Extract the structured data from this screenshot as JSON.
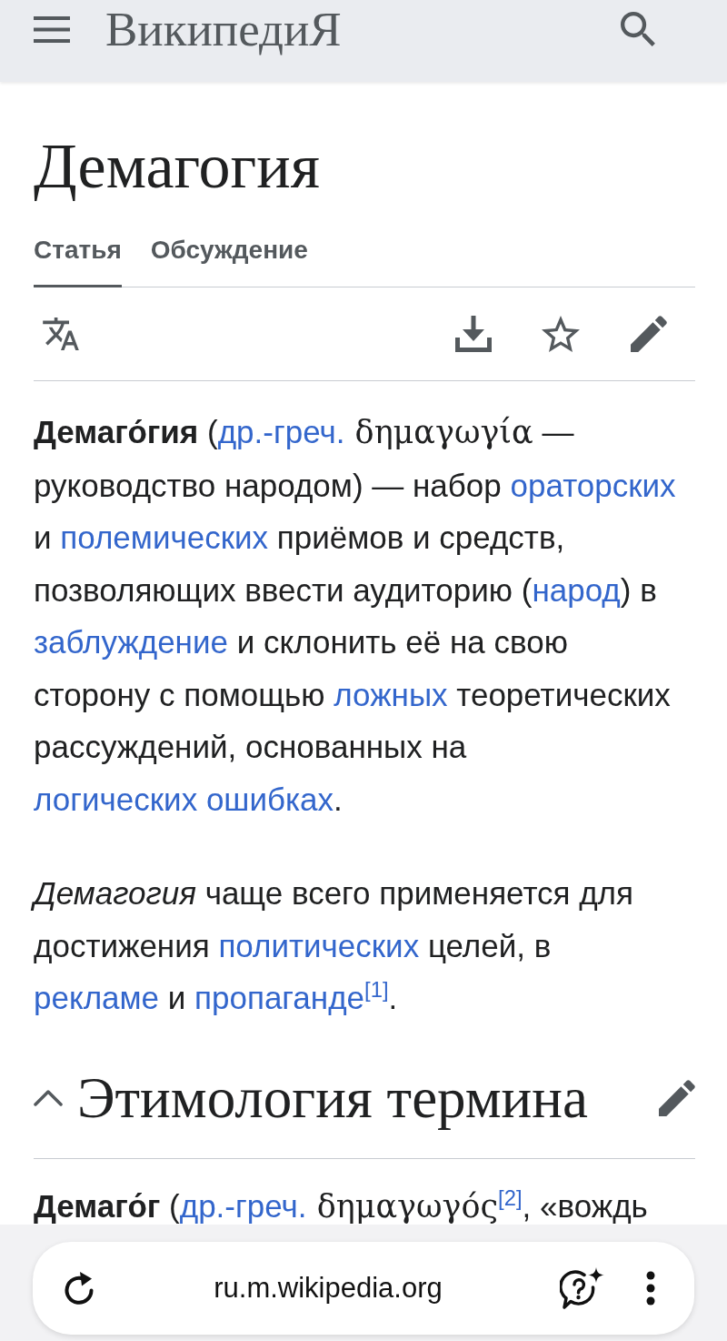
{
  "header": {
    "logo": "ВикипедиЯ"
  },
  "page": {
    "title": "Демагогия",
    "tabs": [
      {
        "label": "Статья",
        "selected": true
      },
      {
        "label": "Обсуждение",
        "selected": false
      }
    ]
  },
  "article": {
    "paragraphs": [
      [
        {
          "kind": "text",
          "text": "**Демаго́гия** ("
        },
        {
          "kind": "link",
          "text": "др.-греч."
        },
        {
          "kind": "foreign",
          "text": " δημαγωγία"
        },
        {
          "kind": "text",
          "text": " — руководство народом) — набор "
        },
        {
          "kind": "link",
          "text": "ораторских"
        },
        {
          "kind": "text",
          "text": " и "
        },
        {
          "kind": "link",
          "text": "полемических"
        },
        {
          "kind": "text",
          "text": " приёмов и средств, позволяющих ввести аудиторию ("
        },
        {
          "kind": "link",
          "text": "народ"
        },
        {
          "kind": "text",
          "text": ") в "
        },
        {
          "kind": "link",
          "text": "заблуждение"
        },
        {
          "kind": "text",
          "text": " и склонить её на свою сторону с помощью "
        },
        {
          "kind": "link",
          "text": "ложных"
        },
        {
          "kind": "text",
          "text": " теоретических рассуждений, основанных на "
        },
        {
          "kind": "link",
          "text": "логических ошибках"
        },
        {
          "kind": "text",
          "text": "."
        }
      ],
      [
        {
          "kind": "text",
          "text": "*Демагогия* чаще всего применяется для достижения "
        },
        {
          "kind": "link",
          "text": "политических"
        },
        {
          "kind": "text",
          "text": " целей, в "
        },
        {
          "kind": "link",
          "text": "рекламе"
        },
        {
          "kind": "text",
          "text": " и "
        },
        {
          "kind": "link",
          "text": "пропаганде"
        },
        {
          "kind": "ref",
          "text": "[1]"
        },
        {
          "kind": "text",
          "text": "."
        }
      ]
    ],
    "sections": [
      {
        "heading": "Этимология термина",
        "expanded": true,
        "paragraphs": [
          [
            {
              "kind": "text",
              "text": "**Демаго́г** ("
            },
            {
              "kind": "link",
              "text": "др.-греч."
            },
            {
              "kind": "foreign",
              "text": " δημαγωγός"
            },
            {
              "kind": "ref",
              "text": "[2]"
            },
            {
              "kind": "text",
              "text": ", «вождь"
            }
          ]
        ]
      }
    ]
  },
  "browser_bar": {
    "url": "ru.m.wikipedia.org"
  }
}
